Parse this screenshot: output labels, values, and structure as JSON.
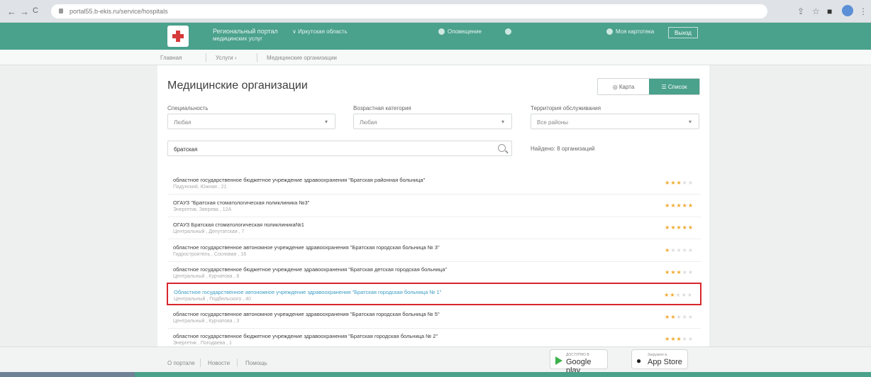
{
  "browser": {
    "back": "←",
    "forward": "→",
    "reload": "C",
    "url": "portal55.b-ekis.ru/service/hospitals",
    "icons": [
      "share-icon",
      "star-icon",
      "extension-icon",
      "profile-icon",
      "menu-icon"
    ]
  },
  "header": {
    "portal_name_line1": "Региональный портал",
    "portal_name_line2": "медицинских услуг",
    "region": "∨ Иркутская область",
    "notifications": "Оповещение",
    "my_card": "Моя картотека",
    "exit": "Выход"
  },
  "breadcrumbs": [
    "Главная",
    "Услуги ›",
    "Медицинские организации"
  ],
  "page": {
    "title": "Медицинские организации",
    "view_map": "Карта",
    "view_list": "Список"
  },
  "filters": [
    {
      "label": "Специальность",
      "value": "Любая"
    },
    {
      "label": "Возрастная категория",
      "value": "Любая"
    },
    {
      "label": "Территория обслуживания",
      "value": "Все районы"
    }
  ],
  "search": {
    "value": "братская"
  },
  "found_text": "Найдено: 8 организаций",
  "rows": [
    {
      "name": "областное государственное бюджетное учреждение здравоохранения \"Братская районная больница\"",
      "address": "Падунский, Южная , 21",
      "rating": 3,
      "selected": false
    },
    {
      "name": "ОГАУЗ \"Братская стоматологическая поликлиника №3\"",
      "address": "Энергетик, Зверева , 12А",
      "rating": 5,
      "selected": false
    },
    {
      "name": "ОГАУЗ Братская стоматологическая поликлиника№1",
      "address": "Центральный , Депутатская , 7",
      "rating": 5,
      "selected": false
    },
    {
      "name": "областное государственное автономное учреждение здравоохранения \"Братская городская больница № 3\"",
      "address": "Гидростроитель , Сосновая , 16",
      "rating": 1,
      "selected": false
    },
    {
      "name": "областное государственное бюджетное учреждение здравоохранения \"Братская детская городская больница\"",
      "address": "Центральный , Курчатова , 8",
      "rating": 3,
      "selected": false
    },
    {
      "name": "Областное государственное автономное учреждение здравоохранения \"Братская городская больница № 1\"",
      "address": "Центральный , Подбельского , 40",
      "rating": 2,
      "selected": true
    },
    {
      "name": "областное государственное автономное учреждение здравоохранения \"Братская городская больница № 5\"",
      "address": "Центральный , Курчатова , 3",
      "rating": 2,
      "selected": false
    },
    {
      "name": "областное государственное бюджетное учреждение здравоохранения \"Братская городская больница № 2\"",
      "address": "Энергетик , Погодаева , 1",
      "rating": 3,
      "selected": false
    }
  ],
  "footer": {
    "links": [
      "О портале",
      "Новости",
      "Помощь"
    ],
    "google_top": "ДОСТУПНО В",
    "google_main": "Google play",
    "apple_top": "Загрузите в",
    "apple_main": "App Store"
  },
  "colors": {
    "accent": "#4aa18c",
    "highlight": "#d8262c",
    "star": "#f0a92e"
  }
}
